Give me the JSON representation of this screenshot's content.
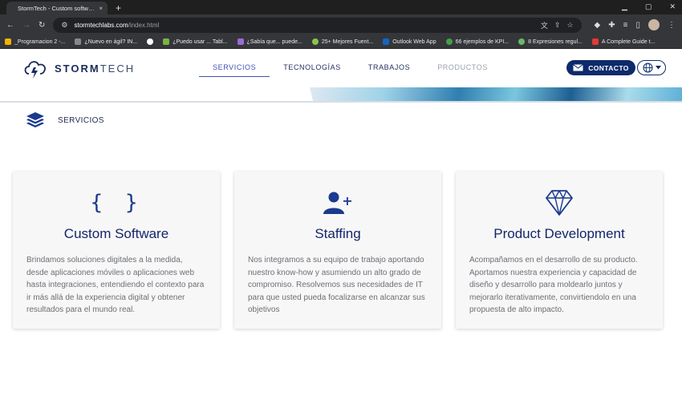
{
  "browser": {
    "tab_title": "StormTech - Custom software de",
    "tab_close": "×",
    "new_tab": "+",
    "url_host": "stormtechlabs.com",
    "url_path": "/index.html",
    "bookmarks": [
      {
        "label": "_Programacion 2 -...",
        "color": "#f0b400"
      },
      {
        "label": "¿Nuevo en ágil? IN...",
        "color": "#888888"
      },
      {
        "label": "",
        "color": "#ffffff"
      },
      {
        "label": "¿Puedo usar ... Tabl...",
        "color": "#7cb342"
      },
      {
        "label": "¿Sabía que... puede...",
        "color": "#9c6ad5"
      },
      {
        "label": "25+ Mejores Fuent...",
        "color": "#8bc34a"
      },
      {
        "label": "Outlook Web App",
        "color": "#1565c0"
      },
      {
        "label": "66 ejemplos de KPI...",
        "color": "#43a047"
      },
      {
        "label": "8 Expresiones regul...",
        "color": "#66bb6a"
      },
      {
        "label": "A Complete Guide t...",
        "color": "#e53935"
      }
    ]
  },
  "header": {
    "logo_strong": "STORM",
    "logo_light": "TECH",
    "nav": [
      {
        "label": "SERVICIOS",
        "state": "active"
      },
      {
        "label": "TECNOLOGÍAS",
        "state": "normal"
      },
      {
        "label": "TRABAJOS",
        "state": "normal"
      },
      {
        "label": "PRODUCTOS",
        "state": "muted"
      }
    ],
    "contact_label": "CONTACTO"
  },
  "section": {
    "title": "SERVICIOS"
  },
  "cards": [
    {
      "icon": "code-braces-icon",
      "icon_text": "{ }",
      "title": "Custom Software",
      "text": "Brindamos soluciones digitales a la medida, desde aplicaciones móviles o aplicaciones web hasta integraciones, entendiendo el contexto para ir más allá de la experiencia digital y obtener resultados para el mundo real."
    },
    {
      "icon": "add-user-icon",
      "title": "Staffing",
      "text": "Nos integramos a su equipo de trabajo aportando nuestro know-how y asumiendo un alto grado de compromiso. Resolvemos sus necesidades de IT para que usted pueda focalizarse en alcanzar sus objetivos"
    },
    {
      "icon": "diamond-icon",
      "title": "Product Development",
      "text": "Acompañamos en el desarrollo de su producto. Aportamos nuestra experiencia y capacidad de diseño y desarrollo para moldearlo juntos y mejorarlo iterativamente, convirtiendolo en una propuesta de alto impacto."
    }
  ],
  "colors": {
    "brand_navy": "#0d2a6b",
    "nav_active": "#3f51b5",
    "card_title": "#14256a"
  }
}
